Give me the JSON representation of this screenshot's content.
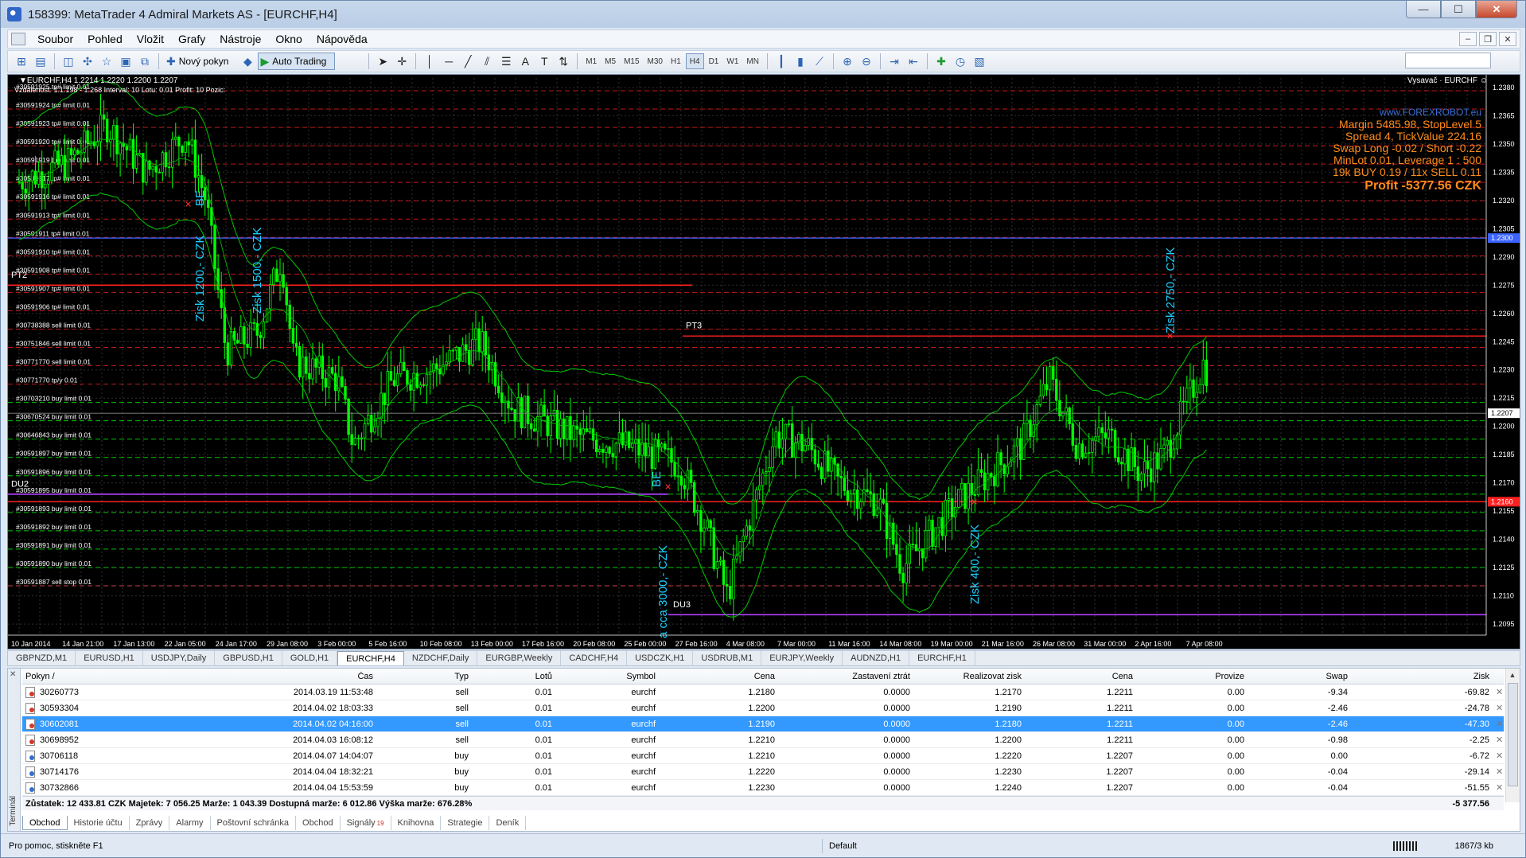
{
  "window": {
    "title": "158399: MetaTrader 4 Admiral Markets AS - [EURCHF,H4]",
    "controls": {
      "minimize": "—",
      "maximize": "☐",
      "close": "✕"
    }
  },
  "menu": {
    "items": [
      "Soubor",
      "Pohled",
      "Vložit",
      "Grafy",
      "Nástroje",
      "Okno",
      "Nápověda"
    ],
    "mdi_controls": [
      "‒",
      "❐",
      "✕"
    ]
  },
  "toolbar": {
    "new_order": "Nový pokyn",
    "auto_trading": "Auto Trading",
    "timeframes": [
      "M1",
      "M5",
      "M15",
      "M30",
      "H1",
      "H4",
      "D1",
      "W1",
      "MN"
    ],
    "active_timeframe": "H4"
  },
  "chart": {
    "header": "▼EURCHF,H4  1.2214 1.2220 1.2200 1.2207",
    "header2": "Vzdálenost: 1.1.198 - 1.268   Interval: 10   Lotu: 0.01   Profit: 10   Pozic:",
    "indicator": "Vysavač · EURCHF ☺",
    "info": {
      "site": "www.FOREXROBOT.eu",
      "lines": [
        "Margin 5485.98, StopLevel 5",
        "Spread 4, TickValue 224.16",
        "Swap Long -0.02 / Short -0.22",
        "MinLot 0.01, Leverage 1 : 500",
        "19k BUY 0.19 / 11x SELL 0.11"
      ],
      "profit": "Profit -5377.56 CZK"
    },
    "price_labels": [
      "1.2380",
      "1.2365",
      "1.2350",
      "1.2335",
      "1.2320",
      "1.2305",
      "1.2290",
      "1.2275",
      "1.2260",
      "1.2245",
      "1.2230",
      "1.2215",
      "1.2200",
      "1.2185",
      "1.2170",
      "1.2155",
      "1.2140",
      "1.2125",
      "1.2110",
      "1.2095"
    ],
    "current_price": "1.2207",
    "blue_line_price": "1.2300",
    "red_line_price": "1.2160",
    "time_labels": [
      "10 Jan 2014",
      "14 Jan 21:00",
      "17 Jan 13:00",
      "22 Jan 05:00",
      "24 Jan 17:00",
      "29 Jan 08:00",
      "3 Feb 00:00",
      "5 Feb 16:00",
      "10 Feb 08:00",
      "13 Feb 00:00",
      "17 Feb 16:00",
      "20 Feb 08:00",
      "25 Feb 00:00",
      "27 Feb 16:00",
      "4 Mar 08:00",
      "7 Mar 00:00",
      "11 Mar 16:00",
      "14 Mar 08:00",
      "19 Mar 00:00",
      "21 Mar 16:00",
      "26 Mar 08:00",
      "31 Mar 00:00",
      "2 Apr 16:00",
      "7 Apr 08:00"
    ],
    "order_labels": [
      "#30591925 tp# limit 0.01",
      "#30591924 tp# limit 0.01",
      "#30591923 tp# limit 0.01",
      "#30591920 tp# limit 0.01",
      "#30591919 tp# limit 0.01",
      "#30591917 tp# limit 0.01",
      "#30591916 tp# limit 0.01",
      "#30591913 tp# limit 0.01",
      "#30591911 tp# limit 0.01",
      "#30591910 tp# limit 0.01",
      "#30591908 tp# limit 0.01",
      "#30591907 tp# limit 0.01",
      "#30591906 tp# limit 0.01",
      "#30738388 sell limit 0.01",
      "#30751846 sell limit 0.01",
      "#30771770 sell limit 0.01",
      "#30771770 tp/y 0.01",
      "#30703210 buy limit 0.01",
      "#30670524 buy limit 0.01",
      "#30646843 buy limit 0.01",
      "#30591897 buy limit 0.01",
      "#30591896 buy limit 0.01",
      "#30591895 buy limit 0.01",
      "#30591893 buy limit 0.01",
      "#30591892 buy limit 0.01",
      "#30591891 buy limit 0.01",
      "#30591890 buy limit 0.01",
      "#30591887 sell stop 0.01"
    ],
    "annotations": {
      "pt2": "PT2",
      "pt3": "PT3",
      "du2": "DU2",
      "du3": "DU3",
      "be1": "BE",
      "be2": "BE",
      "zisk1": "Zisk 1200,- CZK",
      "zisk2": "Zisk 1500,- CZK",
      "zisk3": "a cca 3000,- CZK",
      "zisk4": "Zisk 400,- CZK",
      "zisk5": "Zisk 2750,- CZK"
    },
    "colors": {
      "bull": "#00ff00",
      "bear": "#00ff00",
      "grid": "#3c3c3c",
      "redline": "#ff2020",
      "blueline": "#3a63ff",
      "purple": "#b040ff"
    }
  },
  "chart_tabs": [
    "GBPNZD,M1",
    "EURUSD,H1",
    "USDJPY,Daily",
    "GBPUSD,H1",
    "GOLD,H1",
    "EURCHF,H4",
    "NZDCHF,Daily",
    "EURGBP,Weekly",
    "CADCHF,H4",
    "USDCZK,H1",
    "USDRUB,M1",
    "EURJPY,Weekly",
    "AUDNZD,H1",
    "EURCHF,H1"
  ],
  "active_chart_tab": "EURCHF,H4",
  "terminal": {
    "side_label": "Terminál",
    "close": "✕",
    "columns": [
      "Pokyn /",
      "Čas",
      "Typ",
      "Lotů",
      "Symbol",
      "Cena",
      "Zastavení ztrát",
      "Realizovat zisk",
      "Cena",
      "Provize",
      "Swap",
      "Zisk"
    ],
    "rows": [
      {
        "order": "30260773",
        "time": "2014.03.19 11:53:48",
        "type": "sell",
        "lots": "0.01",
        "symbol": "eurchf",
        "price": "1.2180",
        "sl": "0.0000",
        "tp": "1.2170",
        "cur": "1.2211",
        "comm": "0.00",
        "swap": "-9.34",
        "profit": "-69.82"
      },
      {
        "order": "30593304",
        "time": "2014.04.02 18:03:33",
        "type": "sell",
        "lots": "0.01",
        "symbol": "eurchf",
        "price": "1.2200",
        "sl": "0.0000",
        "tp": "1.2190",
        "cur": "1.2211",
        "comm": "0.00",
        "swap": "-2.46",
        "profit": "-24.78"
      },
      {
        "order": "30602081",
        "time": "2014.04.02 04:16:00",
        "type": "sell",
        "lots": "0.01",
        "symbol": "eurchf",
        "price": "1.2190",
        "sl": "0.0000",
        "tp": "1.2180",
        "cur": "1.2211",
        "comm": "0.00",
        "swap": "-2.46",
        "profit": "-47.30"
      },
      {
        "order": "30698952",
        "time": "2014.04.03 16:08:12",
        "type": "sell",
        "lots": "0.01",
        "symbol": "eurchf",
        "price": "1.2210",
        "sl": "0.0000",
        "tp": "1.2200",
        "cur": "1.2211",
        "comm": "0.00",
        "swap": "-0.98",
        "profit": "-2.25"
      },
      {
        "order": "30706118",
        "time": "2014.04.07 14:04:07",
        "type": "buy",
        "lots": "0.01",
        "symbol": "eurchf",
        "price": "1.2210",
        "sl": "0.0000",
        "tp": "1.2220",
        "cur": "1.2207",
        "comm": "0.00",
        "swap": "0.00",
        "profit": "-6.72"
      },
      {
        "order": "30714176",
        "time": "2014.04.04 18:32:21",
        "type": "buy",
        "lots": "0.01",
        "symbol": "eurchf",
        "price": "1.2220",
        "sl": "0.0000",
        "tp": "1.2230",
        "cur": "1.2207",
        "comm": "0.00",
        "swap": "-0.04",
        "profit": "-29.14"
      },
      {
        "order": "30732866",
        "time": "2014.04.04 15:53:59",
        "type": "buy",
        "lots": "0.01",
        "symbol": "eurchf",
        "price": "1.2230",
        "sl": "0.0000",
        "tp": "1.2240",
        "cur": "1.2207",
        "comm": "0.00",
        "swap": "-0.04",
        "profit": "-51.55"
      }
    ],
    "selected_row": 2,
    "summary": "Zůstatek: 12 433.81 CZK  Majetek: 7 056.25  Marže: 1 043.39  Dostupná marže: 6 012.86  Výška marže: 676.28%",
    "summary_profit": "-5 377.56",
    "tabs": [
      "Obchod",
      "Historie účtu",
      "Zprávy",
      "Alarmy",
      "Poštovní schránka",
      "Obchod",
      "Signály",
      "Knihovna",
      "Strategie",
      "Deník"
    ],
    "signals_badge": "19",
    "active_tab": "Obchod"
  },
  "status": {
    "help": "Pro pomoc, stiskněte F1",
    "profile": "Default",
    "traffic": "1867/3 kb"
  }
}
